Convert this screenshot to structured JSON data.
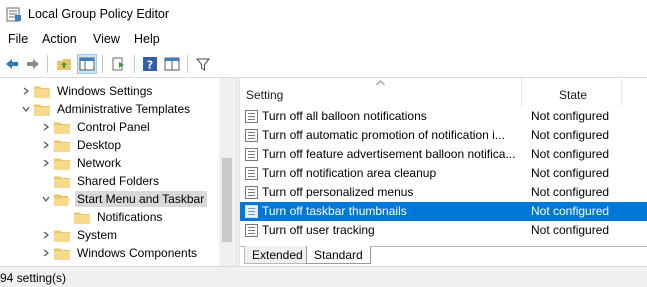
{
  "window": {
    "title": "Local Group Policy Editor",
    "icon": "group-policy-icon"
  },
  "menubar": {
    "items": [
      "File",
      "Action",
      "View",
      "Help"
    ]
  },
  "toolbar": {
    "buttons": [
      "back-icon",
      "forward-icon",
      "up-folder-icon",
      "show-hide-tree-icon",
      "export-list-icon",
      "help-icon",
      "extended-view-icon",
      "filter-icon"
    ]
  },
  "tree": {
    "items": [
      {
        "label": "Windows Settings",
        "expanded": false
      },
      {
        "label": "Administrative Templates",
        "expanded": true
      },
      {
        "label": "Control Panel",
        "expanded": false
      },
      {
        "label": "Desktop",
        "expanded": false
      },
      {
        "label": "Network",
        "expanded": false
      },
      {
        "label": "Shared Folders",
        "expanded": false
      },
      {
        "label": "Start Menu and Taskbar",
        "expanded": true,
        "selected": true
      },
      {
        "label": "Notifications"
      },
      {
        "label": "System",
        "expanded": false
      },
      {
        "label": "Windows Components",
        "expanded": false
      }
    ]
  },
  "list": {
    "headers": {
      "setting": "Setting",
      "state": "State"
    },
    "rows": [
      {
        "setting": "Turn off all balloon notifications",
        "state": "Not configured"
      },
      {
        "setting": "Turn off automatic promotion of notification i...",
        "state": "Not configured"
      },
      {
        "setting": "Turn off feature advertisement balloon notifica...",
        "state": "Not configured"
      },
      {
        "setting": "Turn off notification area cleanup",
        "state": "Not configured"
      },
      {
        "setting": "Turn off personalized menus",
        "state": "Not configured"
      },
      {
        "setting": "Turn off taskbar thumbnails",
        "state": "Not configured",
        "selected": true
      },
      {
        "setting": "Turn off user tracking",
        "state": "Not configured"
      }
    ]
  },
  "tabs": [
    {
      "label": "Extended",
      "active": false
    },
    {
      "label": "Standard",
      "active": true
    }
  ],
  "status": {
    "text": "94 setting(s)"
  },
  "colors": {
    "selection": "#0078d7",
    "tree_selection": "#d9d9d9",
    "folder": "#e8c46a"
  }
}
